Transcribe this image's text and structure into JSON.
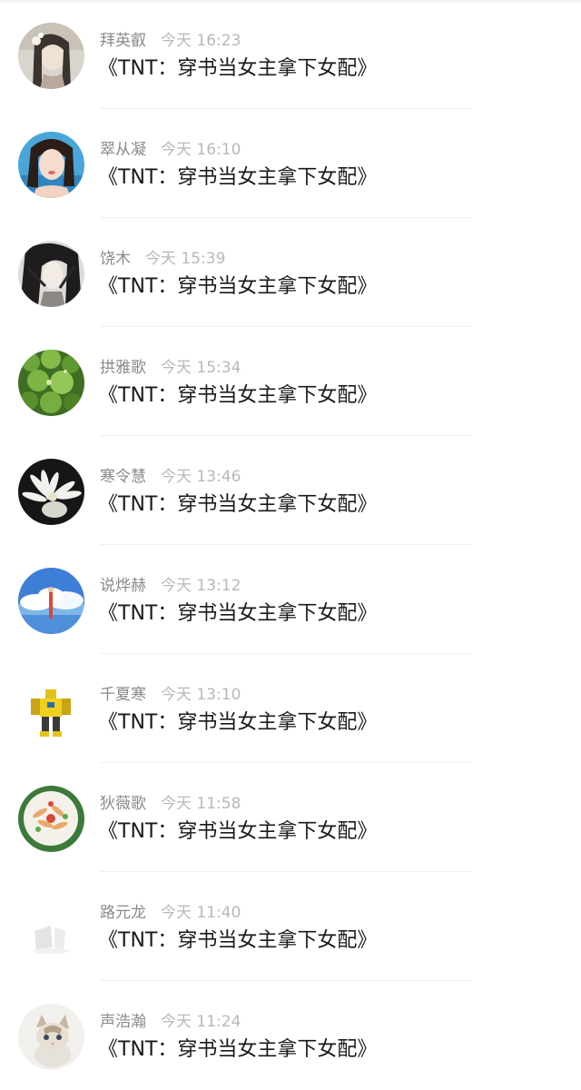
{
  "comments": [
    {
      "name": "拜英叡",
      "time": "今天 16:23",
      "message": "《TNT：穿书当女主拿下女配》",
      "avatar_icon": "portrait-woman-flower-avatar"
    },
    {
      "name": "翠从凝",
      "time": "今天 16:10",
      "message": "《TNT：穿书当女主拿下女配》",
      "avatar_icon": "portrait-woman-selfie-avatar"
    },
    {
      "name": "饶木",
      "time": "今天 15:39",
      "message": "《TNT：穿书当女主拿下女配》",
      "avatar_icon": "anime-long-hair-avatar"
    },
    {
      "name": "拱雅歌",
      "time": "今天 15:34",
      "message": "《TNT：穿书当女主拿下女配》",
      "avatar_icon": "green-leaves-avatar"
    },
    {
      "name": "寒令慧",
      "time": "今天 13:46",
      "message": "《TNT：穿书当女主拿下女配》",
      "avatar_icon": "white-flower-avatar"
    },
    {
      "name": "说烨赫",
      "time": "今天 13:12",
      "message": "《TNT：穿书当女主拿下女配》",
      "avatar_icon": "sky-cloud-figure-avatar"
    },
    {
      "name": "千夏寒",
      "time": "今天 13:10",
      "message": "《TNT：穿书当女主拿下女配》",
      "avatar_icon": "yellow-robot-avatar"
    },
    {
      "name": "狄薇歌",
      "time": "今天 11:58",
      "message": "《TNT：穿书当女主拿下女配》",
      "avatar_icon": "food-plate-avatar"
    },
    {
      "name": "路元龙",
      "time": "今天 11:40",
      "message": "《TNT：穿书当女主拿下女配》",
      "avatar_icon": "faint-white-object-avatar"
    },
    {
      "name": "声浩瀚",
      "time": "今天 11:24",
      "message": "《TNT：穿书当女主拿下女配》",
      "avatar_icon": "kitten-avatar"
    }
  ]
}
